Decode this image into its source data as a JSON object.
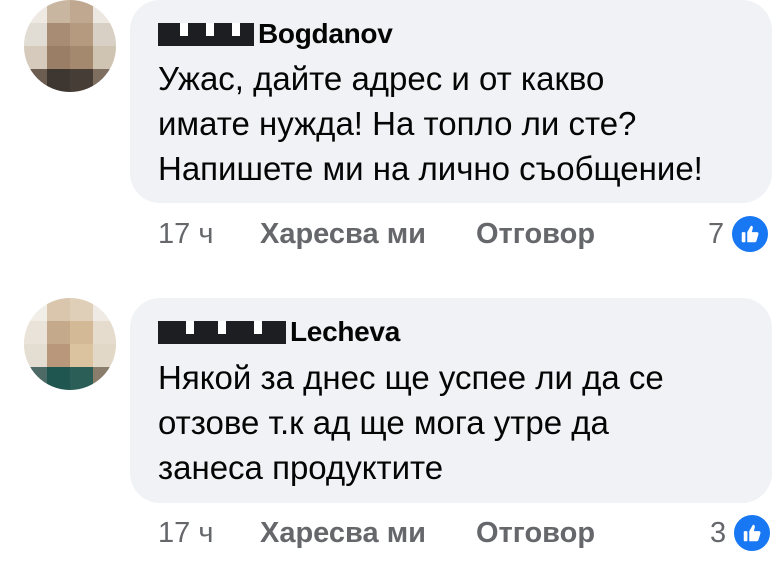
{
  "comments": [
    {
      "author_visible": "Bogdanov",
      "text_lines": [
        "Ужас, дайте адрес и от какво",
        "имате нужда! На топло ли сте?",
        "Напишете ми на лично съобщение!"
      ],
      "time": "17 ч",
      "like_label": "Харесва ми",
      "reply_label": "Отговор",
      "reactions_count": "7",
      "reaction_icon": "thumbs-up-icon"
    },
    {
      "author_visible": "Lecheva",
      "text_lines": [
        "Някой за днес ще успее ли да се",
        "отзове т.к ад ще мога утре да",
        "занеса продуктите"
      ],
      "time": "17 ч",
      "like_label": "Харесва ми",
      "reply_label": "Отговор",
      "reactions_count": "3",
      "reaction_icon": "thumbs-up-icon"
    }
  ],
  "colors": {
    "bubble": "#f0f2f5",
    "text": "#050505",
    "secondary": "#65676b",
    "like_blue": "#1877f2"
  }
}
